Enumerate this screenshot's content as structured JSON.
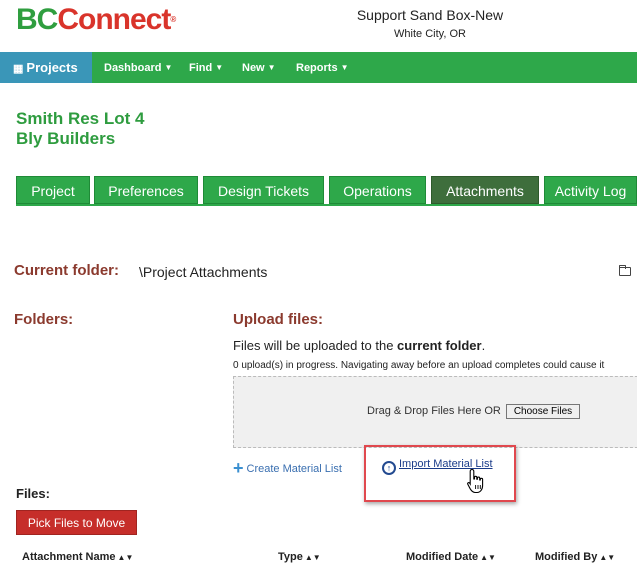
{
  "header": {
    "logo_bc": "BC",
    "logo_connect": "Connect",
    "logo_reg": "®",
    "org_name": "Support Sand Box-New",
    "org_location": "White City, OR"
  },
  "nav": {
    "projects": "Projects",
    "items": [
      "Dashboard",
      "Find",
      "New",
      "Reports"
    ]
  },
  "project": {
    "name": "Smith Res Lot 4",
    "builder": "Bly Builders"
  },
  "tabs": [
    "Project",
    "Preferences",
    "Design Tickets",
    "Operations",
    "Attachments",
    "Activity Log"
  ],
  "active_tab": "Attachments",
  "current_folder": {
    "label": "Current folder:",
    "path": "\\Project Attachments"
  },
  "folders_label": "Folders:",
  "upload": {
    "heading": "Upload files:",
    "desc_prefix": "Files will be uploaded to the ",
    "desc_bold": "current folder",
    "desc_suffix": ".",
    "progress": "0 upload(s) in progress. Navigating away before an upload completes could cause it",
    "drop_text": "Drag & Drop Files Here OR",
    "choose_files": "Choose Files"
  },
  "links": {
    "create_material": "Create Material List",
    "import_material": "Import Material List"
  },
  "files": {
    "label": "Files:",
    "pick_button": "Pick Files to Move",
    "columns": [
      "Attachment Name",
      "Type",
      "Modified Date",
      "Modified By"
    ]
  },
  "colors": {
    "brand_green": "#2ea84a",
    "projects_blue": "#3a96b8",
    "active_tab": "#3e6e3c",
    "heading_red": "#8b3a2e",
    "pick_button_red": "#c62e2a",
    "highlight_red": "#e0484e"
  }
}
